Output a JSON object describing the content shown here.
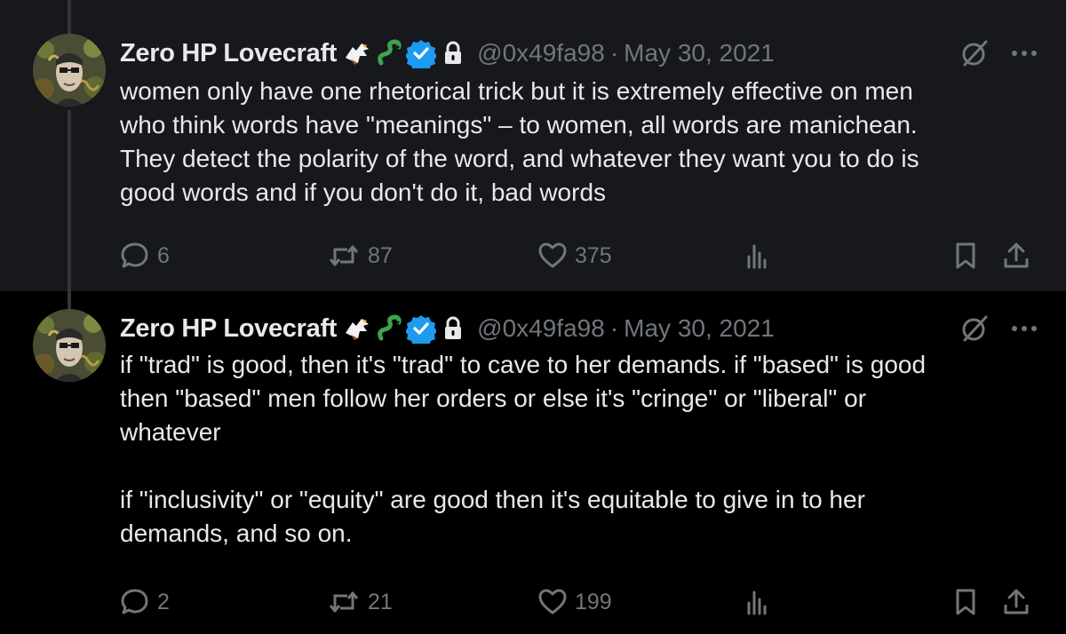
{
  "tweets": [
    {
      "author": {
        "name": "Zero HP Lovecraft",
        "handle": "@0x49fa98",
        "badges": [
          "eagle-emoji",
          "snake-emoji",
          "verified-badge",
          "lock-icon"
        ]
      },
      "separator": "·",
      "date": "May 30, 2021",
      "text": "women only have one rhetorical trick but it is extremely effective on men\nwho think words have \"meanings\" – to women, all words are manichean.\nThey detect the polarity of the word, and whatever they want you to do is\ngood words and if you don't do it, bad words",
      "stats": {
        "replies": "6",
        "retweets": "87",
        "likes": "375"
      }
    },
    {
      "author": {
        "name": "Zero HP Lovecraft",
        "handle": "@0x49fa98",
        "badges": [
          "eagle-emoji",
          "snake-emoji",
          "verified-badge",
          "lock-icon"
        ]
      },
      "separator": "·",
      "date": "May 30, 2021",
      "text": "if \"trad\" is good, then it's \"trad\" to cave to her demands. if \"based\" is good\nthen \"based\" men follow her orders or else it's \"cringe\" or \"liberal\" or\nwhatever\n\nif \"inclusivity\" or \"equity\" are good then it's equitable to give in to her\ndemands, and so on.",
      "stats": {
        "replies": "2",
        "retweets": "21",
        "likes": "199"
      }
    }
  ],
  "colors": {
    "background": "#000000",
    "highlighted_tweet_bg": "#16181c",
    "text_primary": "#e7e9ea",
    "text_secondary": "#71767b",
    "verified_blue": "#1d9bf0",
    "thread_line": "#333639"
  }
}
